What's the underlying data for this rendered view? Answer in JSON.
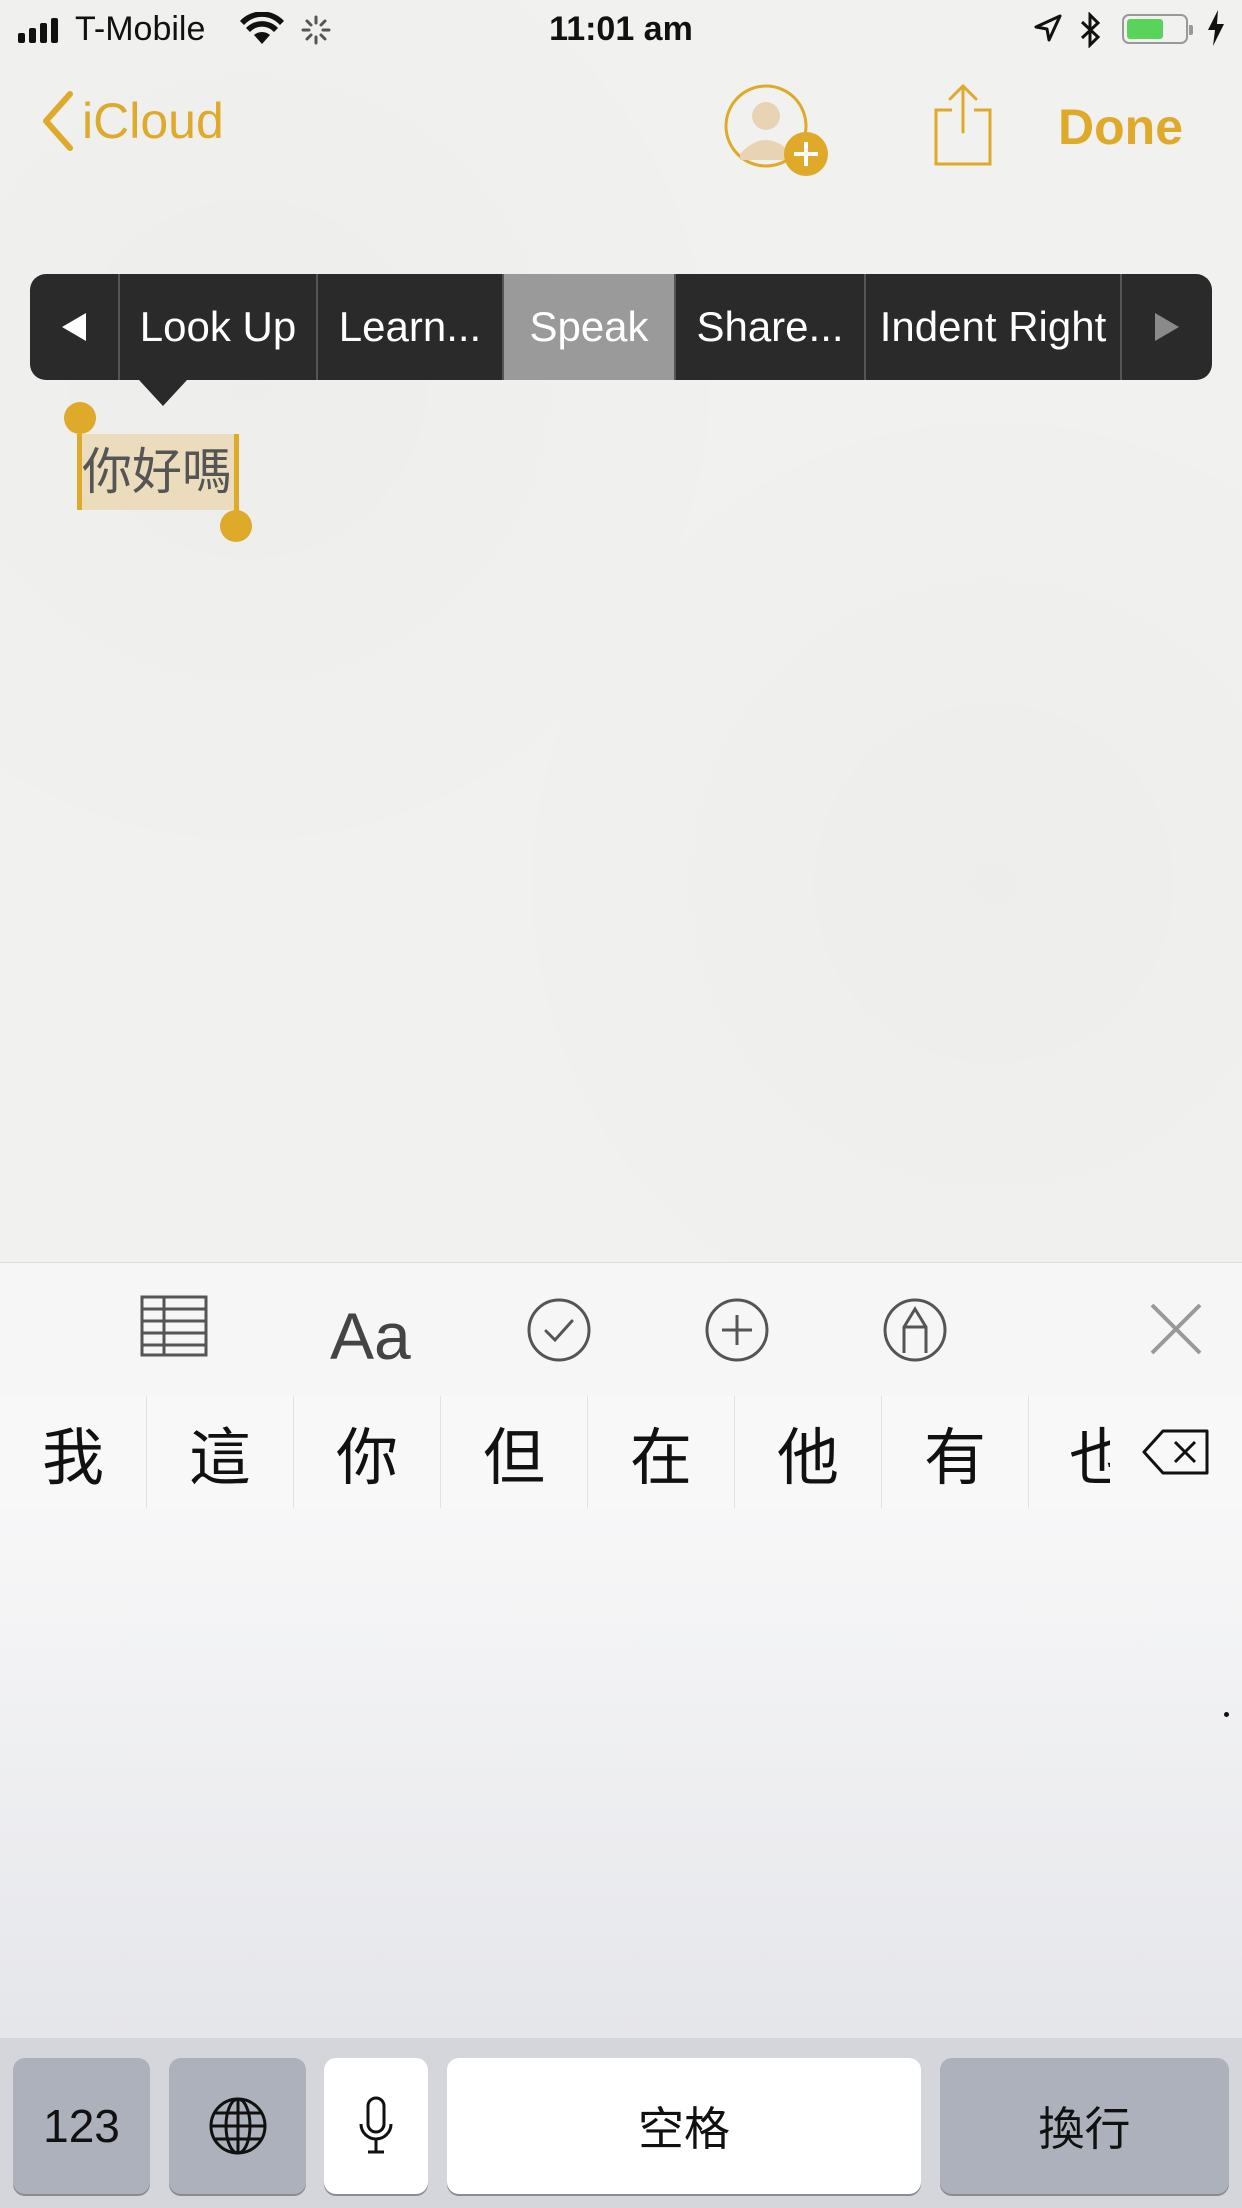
{
  "status_bar": {
    "carrier": "T-Mobile",
    "time": "11:01 am",
    "battery_level": 0.6
  },
  "nav": {
    "back_label": "iCloud",
    "done_label": "Done"
  },
  "edit_menu": {
    "items": [
      "Look Up",
      "Learn...",
      "Speak",
      "Share...",
      "Indent Right"
    ],
    "active_item": "Speak"
  },
  "note": {
    "selected_text": "你好嗎"
  },
  "toolbar": {
    "tools": [
      "table-icon",
      "text-style-icon",
      "checklist-icon",
      "add-icon",
      "markup-icon",
      "close-icon"
    ],
    "text_style_label": "Aa"
  },
  "candidates": [
    "我",
    "這",
    "你",
    "但",
    "在",
    "他",
    "有",
    "也"
  ],
  "keyboard": {
    "numbers_key": "123",
    "space_key": "空格",
    "return_key": "換行"
  },
  "colors": {
    "accent": "#dfa92a",
    "menu_bg": "#2a2a2a"
  }
}
